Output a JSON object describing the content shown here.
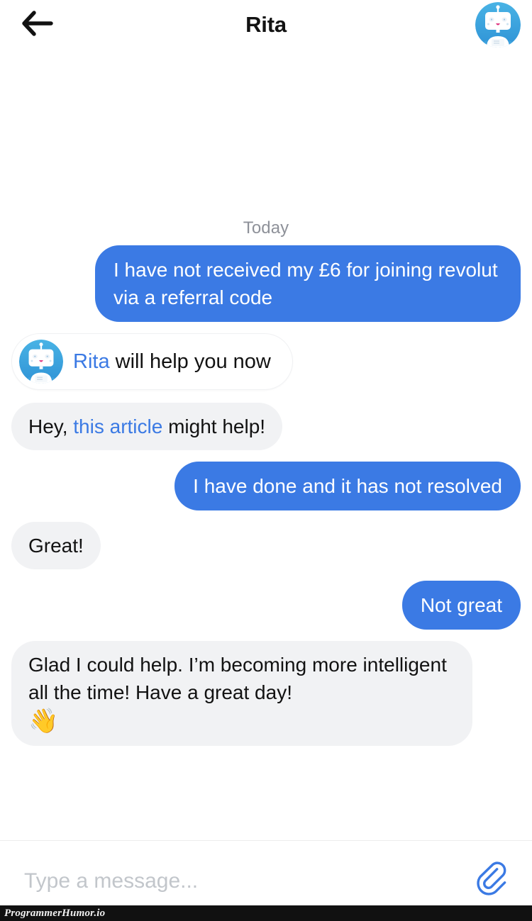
{
  "header": {
    "title": "Rita",
    "back_icon": "back-arrow-icon",
    "avatar_icon": "robot-avatar-icon"
  },
  "chat": {
    "day_label": "Today",
    "messages": [
      {
        "id": "m1",
        "side": "out",
        "text": "I have not received my £6 for joining revolut via a referral code"
      },
      {
        "id": "m2",
        "side": "system",
        "name": "Rita",
        "text": " will help you now"
      },
      {
        "id": "m3",
        "side": "in",
        "text_before": "Hey, ",
        "link": "this article",
        "text_after": " might help!"
      },
      {
        "id": "m4",
        "side": "out",
        "text": "I have done and it has not resolved"
      },
      {
        "id": "m5",
        "side": "in",
        "text": "Great!"
      },
      {
        "id": "m6",
        "side": "out",
        "text": "Not great"
      },
      {
        "id": "m7",
        "side": "in",
        "text": "Glad I could help. I’m becoming more intelligent all the time! Have a great day!",
        "emoji": "👋"
      }
    ]
  },
  "composer": {
    "placeholder": "Type a message...",
    "value": "",
    "attach_icon": "paperclip-icon"
  },
  "watermark": {
    "text": "ProgrammerHumor.io"
  },
  "colors": {
    "accent_blue": "#3b7ae4",
    "bubble_grey": "#f1f2f4",
    "text_dark": "#121212",
    "muted_grey": "#8e9199",
    "placeholder_grey": "#c2c6cb"
  }
}
